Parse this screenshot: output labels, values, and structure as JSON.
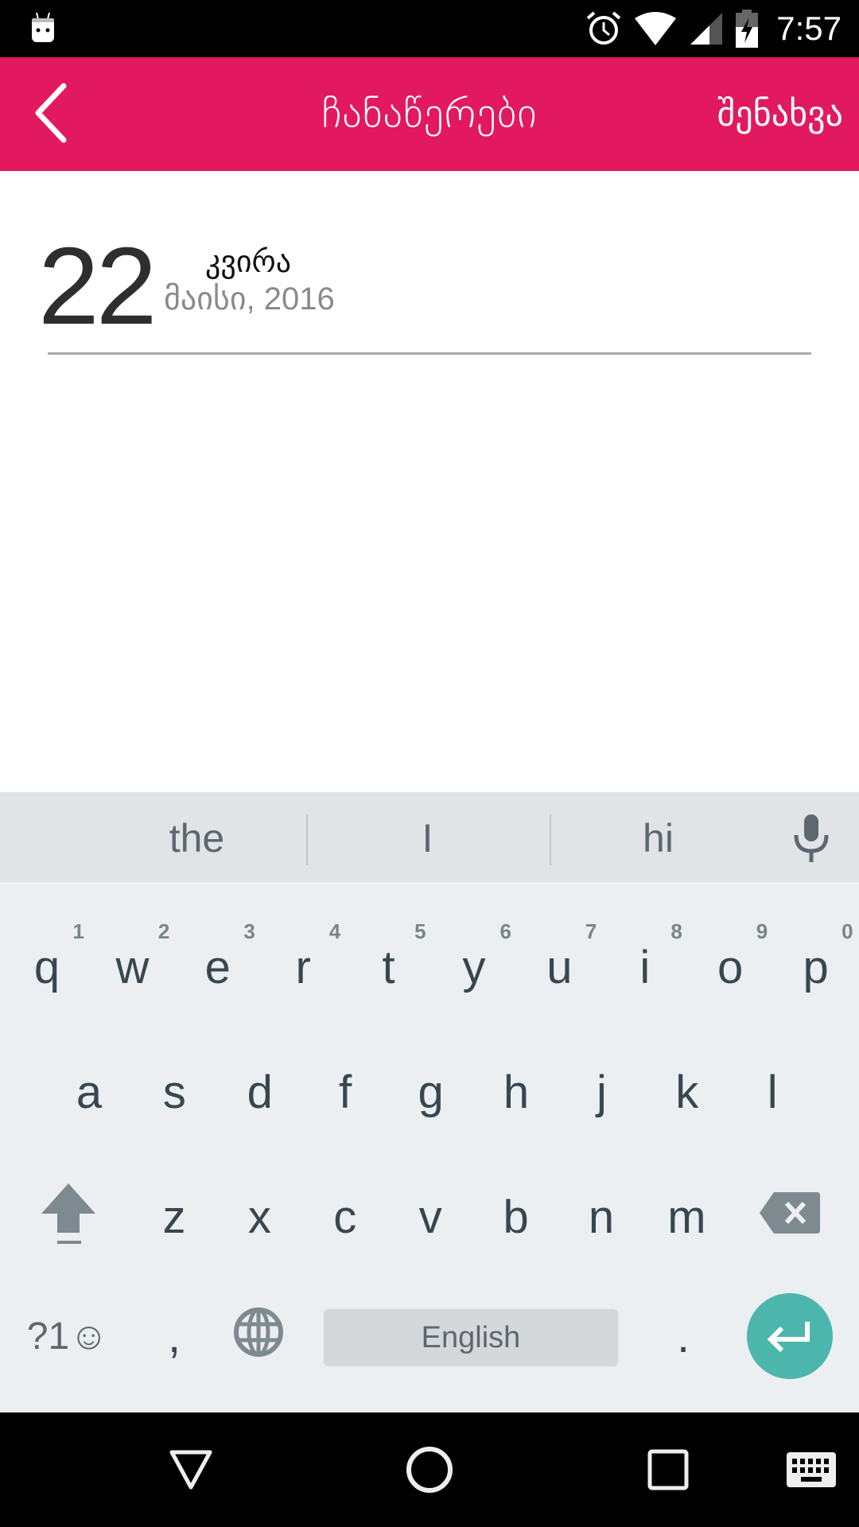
{
  "status_bar": {
    "time": "7:57",
    "icons": [
      "android-notification-icon",
      "alarm-icon",
      "wifi-icon",
      "cellular-signal-icon",
      "battery-charging-icon"
    ]
  },
  "toolbar": {
    "back_icon": "chevron-left-icon",
    "title": "ჩანაწერები",
    "save_label": "შენახვა",
    "color": "#e2195e"
  },
  "entry_date": {
    "day": "22",
    "weekday": "კვირა",
    "month_year": "მაისი, 2016"
  },
  "keyboard": {
    "suggestions": [
      "the",
      "I",
      "hi"
    ],
    "mic_icon": "microphone-icon",
    "rows": [
      [
        {
          "key": "q",
          "hint": "1"
        },
        {
          "key": "w",
          "hint": "2"
        },
        {
          "key": "e",
          "hint": "3"
        },
        {
          "key": "r",
          "hint": "4"
        },
        {
          "key": "t",
          "hint": "5"
        },
        {
          "key": "y",
          "hint": "6"
        },
        {
          "key": "u",
          "hint": "7"
        },
        {
          "key": "i",
          "hint": "8"
        },
        {
          "key": "o",
          "hint": "9"
        },
        {
          "key": "p",
          "hint": "0"
        }
      ],
      [
        {
          "key": "a"
        },
        {
          "key": "s"
        },
        {
          "key": "d"
        },
        {
          "key": "f"
        },
        {
          "key": "g"
        },
        {
          "key": "h"
        },
        {
          "key": "j"
        },
        {
          "key": "k"
        },
        {
          "key": "l"
        }
      ],
      [
        {
          "key": "z"
        },
        {
          "key": "x"
        },
        {
          "key": "c"
        },
        {
          "key": "v"
        },
        {
          "key": "b"
        },
        {
          "key": "n"
        },
        {
          "key": "m"
        }
      ]
    ],
    "symbols_label": "?1☺",
    "comma": ",",
    "period": ".",
    "space_label": "English",
    "enter_color": "#4db6ac"
  },
  "nav_bar": {
    "icons": [
      "back-triangle-icon",
      "home-circle-icon",
      "recents-square-icon",
      "keyboard-switch-icon"
    ]
  }
}
